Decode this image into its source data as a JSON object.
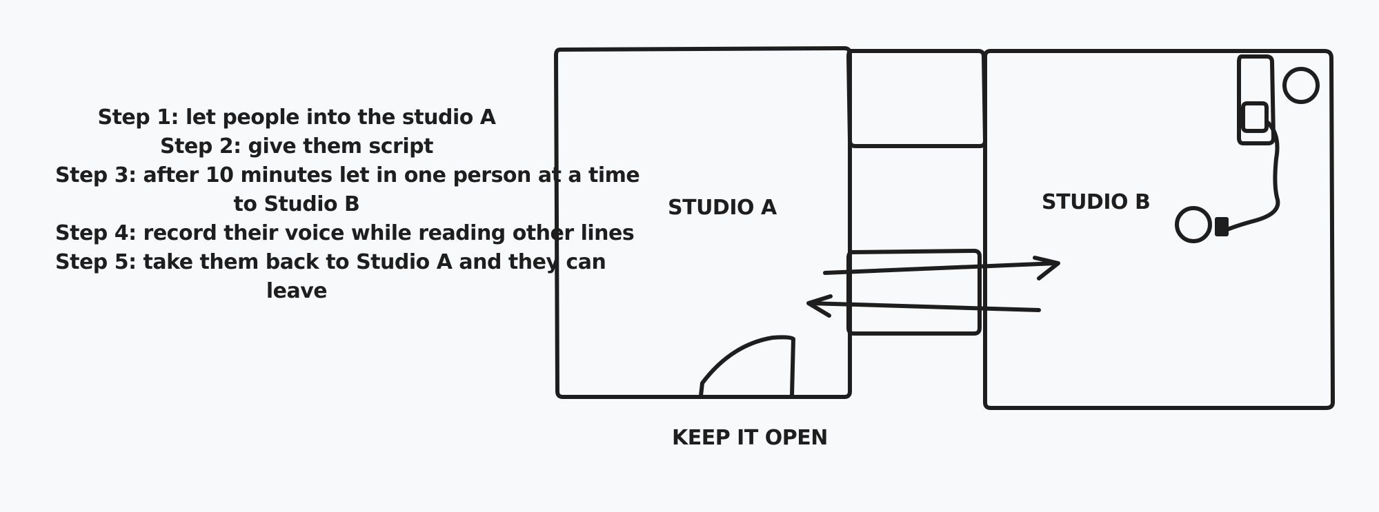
{
  "steps": [
    "Step 1: let people into the studio A",
    "Step 2: give them script",
    "Step 3: after 10 minutes let in one person at a time",
    "to Studio B",
    "Step 4: record their voice while reading other lines",
    "Step 5: take them back to Studio A and they can",
    "leave"
  ],
  "labels": {
    "studio_a": "STUDIO A",
    "studio_b": "STUDIO B",
    "keep_open": "KEEP IT OPEN"
  },
  "colors": {
    "stroke": "#1e1e1e",
    "background": "#f8f9fa"
  }
}
